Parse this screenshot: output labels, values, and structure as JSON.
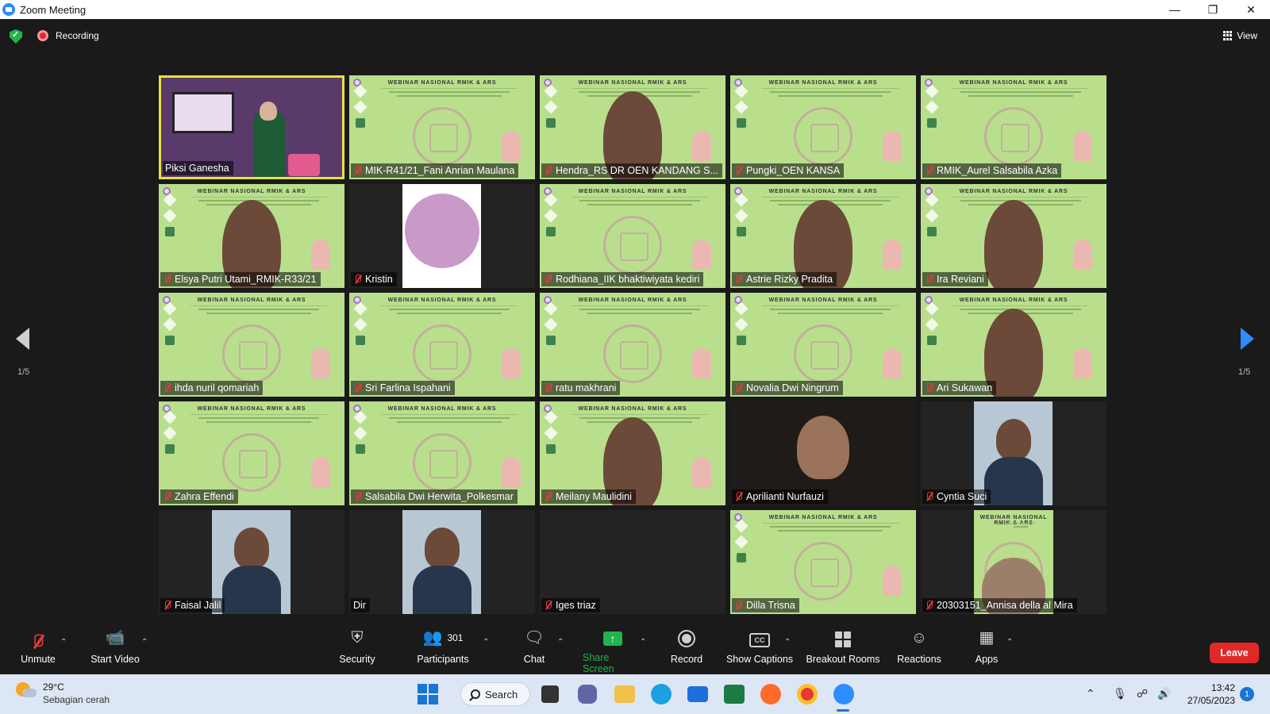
{
  "window": {
    "title": "Zoom Meeting",
    "controls": [
      "minimize",
      "restore",
      "close"
    ]
  },
  "topbar": {
    "recording_label": "Recording",
    "view_label": "View"
  },
  "pagination": {
    "left_label": "1/5",
    "right_label": "1/5"
  },
  "participants": [
    {
      "name": "Piksi Ganesha",
      "muted": false,
      "kind": "camera-room",
      "active_speaker": true
    },
    {
      "name": "MIK-R41/21_Fani Anrian Maulana",
      "muted": true,
      "kind": "slide"
    },
    {
      "name": "Hendra_RS DR OEN KANDANG S...",
      "muted": true,
      "kind": "slide-person"
    },
    {
      "name": "Pungki_OEN KANSA",
      "muted": true,
      "kind": "slide"
    },
    {
      "name": "RMIK_Aurel Salsabila Azka",
      "muted": true,
      "kind": "slide"
    },
    {
      "name": "Elsya Putri Utami_RMIK-R33/21",
      "muted": true,
      "kind": "slide-person"
    },
    {
      "name": "Kristin",
      "muted": true,
      "kind": "avatar-circle"
    },
    {
      "name": "Rodhiana_IIK bhaktiwiyata kediri",
      "muted": true,
      "kind": "slide"
    },
    {
      "name": "Astrie Rizky Pradita",
      "muted": true,
      "kind": "slide-person"
    },
    {
      "name": "Ira Reviani",
      "muted": true,
      "kind": "slide-person"
    },
    {
      "name": "ihda nuril qomariah",
      "muted": true,
      "kind": "slide"
    },
    {
      "name": "Sri Farlina Ispahani",
      "muted": true,
      "kind": "slide"
    },
    {
      "name": "ratu makhrani",
      "muted": true,
      "kind": "slide"
    },
    {
      "name": "Novalia Dwi Ningrum",
      "muted": true,
      "kind": "slide"
    },
    {
      "name": "Ari Sukawan",
      "muted": true,
      "kind": "slide-person"
    },
    {
      "name": "Zahra Effendi",
      "muted": true,
      "kind": "slide"
    },
    {
      "name": "Salsabila Dwi Herwita_Polkesmar",
      "muted": true,
      "kind": "slide"
    },
    {
      "name": "Meilany Maulidini",
      "muted": true,
      "kind": "slide-person"
    },
    {
      "name": "Aprilianti Nurfauzi",
      "muted": true,
      "kind": "camera-dark"
    },
    {
      "name": "Cyntia Suci",
      "muted": true,
      "kind": "avatar-box"
    },
    {
      "name": "Faisal Jalil",
      "muted": true,
      "kind": "avatar-box"
    },
    {
      "name": "Dir",
      "muted": false,
      "kind": "avatar-box"
    },
    {
      "name": "Iges triaz",
      "muted": true,
      "kind": "empty"
    },
    {
      "name": "Dilla Trisna",
      "muted": true,
      "kind": "slide"
    },
    {
      "name": "20303151_Annisa della al Mira",
      "muted": true,
      "kind": "avatar-box-slide"
    }
  ],
  "slide_heading": "WEBINAR NASIONAL RMIK & ARS",
  "toolbar": {
    "unmute": "Unmute",
    "start_video": "Start Video",
    "security": "Security",
    "participants": "Participants",
    "participants_count": "301",
    "chat": "Chat",
    "share_screen": "Share Screen",
    "record": "Record",
    "show_captions": "Show Captions",
    "cc_glyph": "CC",
    "breakout_rooms": "Breakout Rooms",
    "reactions": "Reactions",
    "apps": "Apps",
    "leave": "Leave"
  },
  "taskbar": {
    "temperature": "29°C",
    "weather": "Sebagian cerah",
    "search_label": "Search",
    "time": "13:42",
    "date": "27/05/2023",
    "notification_count": "1"
  },
  "colors": {
    "background": "#1a1a1a",
    "active_border": "#e8e23c",
    "share_green": "#21b54c",
    "leave_red": "#e02828",
    "zoom_blue": "#2d8cff",
    "slide_green": "#b9df8d"
  }
}
